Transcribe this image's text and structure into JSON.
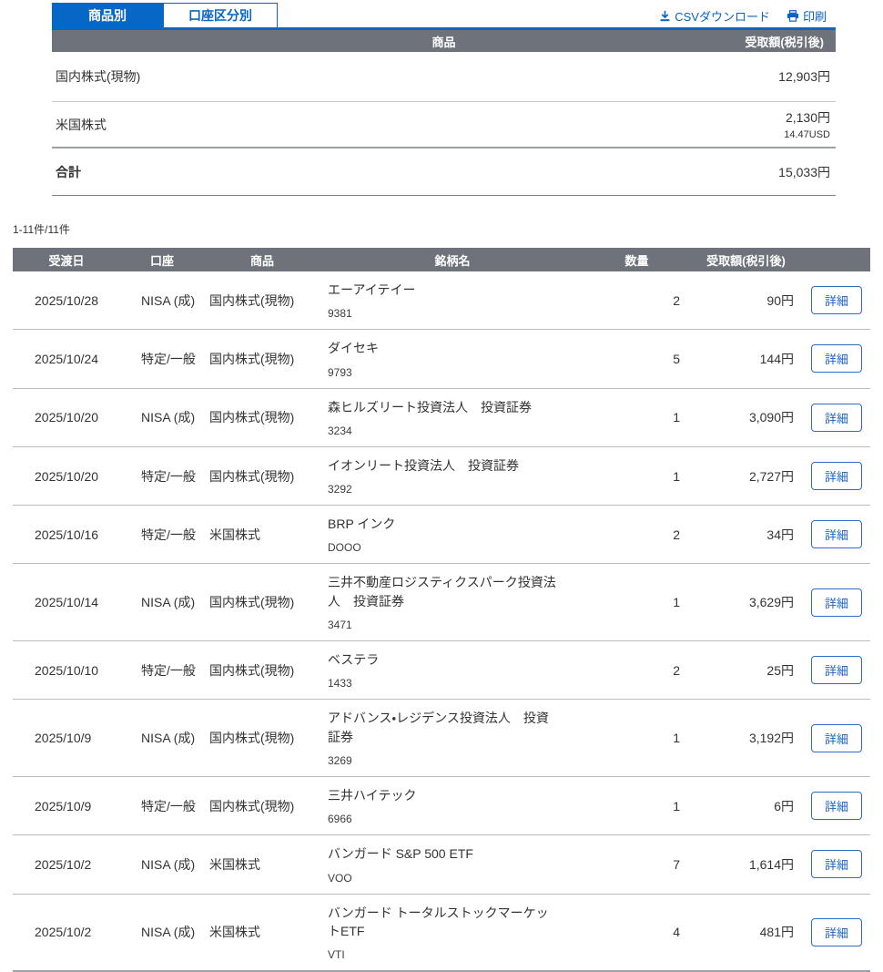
{
  "tabs": [
    {
      "label": "商品別",
      "active": true
    },
    {
      "label": "口座区分別",
      "active": false
    }
  ],
  "actions": {
    "csv_label": "CSVダウンロード",
    "print_label": "印刷"
  },
  "summary": {
    "headers": {
      "product": "商品",
      "amount": "受取額(税引後)"
    },
    "rows": [
      {
        "product": "国内株式(現物)",
        "amount": "12,903円",
        "sub": ""
      },
      {
        "product": "米国株式",
        "amount": "2,130円",
        "sub": "14.47USD"
      }
    ],
    "total": {
      "label": "合計",
      "amount": "15,033円"
    }
  },
  "count_text": "1-11件/11件",
  "table": {
    "headers": [
      "受渡日",
      "口座",
      "商品",
      "銘柄名",
      "数量",
      "受取額(税引後)",
      ""
    ],
    "detail_label": "詳細",
    "rows": [
      {
        "date": "2025/10/28",
        "account": "NISA (成)",
        "product": "国内株式(現物)",
        "name": "エーアイテイー",
        "code": "9381",
        "qty": "2",
        "amount": "90円"
      },
      {
        "date": "2025/10/24",
        "account": "特定/一般",
        "product": "国内株式(現物)",
        "name": "ダイセキ",
        "code": "9793",
        "qty": "5",
        "amount": "144円"
      },
      {
        "date": "2025/10/20",
        "account": "NISA (成)",
        "product": "国内株式(現物)",
        "name": "森ヒルズリート投資法人　投資証券",
        "code": "3234",
        "qty": "1",
        "amount": "3,090円"
      },
      {
        "date": "2025/10/20",
        "account": "特定/一般",
        "product": "国内株式(現物)",
        "name": "イオンリート投資法人　投資証券",
        "code": "3292",
        "qty": "1",
        "amount": "2,727円"
      },
      {
        "date": "2025/10/16",
        "account": "特定/一般",
        "product": "米国株式",
        "name": "BRP インク",
        "code": "DOOO",
        "qty": "2",
        "amount": "34円"
      },
      {
        "date": "2025/10/14",
        "account": "NISA (成)",
        "product": "国内株式(現物)",
        "name": "三井不動産ロジスティクスパーク投資法人　投資証券",
        "code": "3471",
        "qty": "1",
        "amount": "3,629円"
      },
      {
        "date": "2025/10/10",
        "account": "特定/一般",
        "product": "国内株式(現物)",
        "name": "ベステラ",
        "code": "1433",
        "qty": "2",
        "amount": "25円"
      },
      {
        "date": "2025/10/9",
        "account": "NISA (成)",
        "product": "国内株式(現物)",
        "name": "アドバンス・レジデンス投資法人　投資証券",
        "code": "3269",
        "qty": "1",
        "amount": "3,192円"
      },
      {
        "date": "2025/10/9",
        "account": "特定/一般",
        "product": "国内株式(現物)",
        "name": "三井ハイテック",
        "code": "6966",
        "qty": "1",
        "amount": "6円"
      },
      {
        "date": "2025/10/2",
        "account": "NISA (成)",
        "product": "米国株式",
        "name": "バンガード S&P 500 ETF",
        "code": "VOO",
        "qty": "7",
        "amount": "1,614円"
      },
      {
        "date": "2025/10/2",
        "account": "NISA (成)",
        "product": "米国株式",
        "name": "バンガード トータルストックマーケットETF",
        "code": "VTI",
        "qty": "4",
        "amount": "481円"
      }
    ]
  },
  "colors": {
    "accent_blue": "#0667c6",
    "link_blue": "#0b63c4",
    "header_gray": "#6e737b"
  }
}
